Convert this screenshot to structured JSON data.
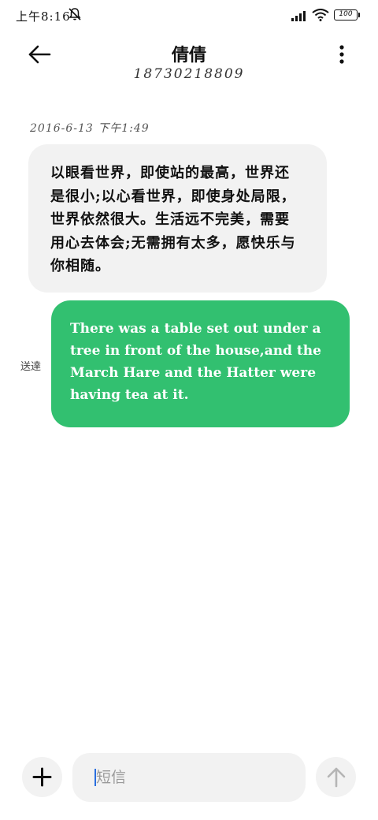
{
  "status_bar": {
    "time": "上午8:16",
    "battery": "100",
    "icons": [
      "mute-icon",
      "signal-icon",
      "wifi-icon",
      "battery-icon"
    ]
  },
  "header": {
    "contact_name": "倩倩",
    "contact_number": "18730218809",
    "icons": [
      "back-arrow-icon",
      "more-vertical-icon"
    ]
  },
  "conversation": {
    "timestamp": "2016-6-13 下午1:49",
    "messages": [
      {
        "direction": "incoming",
        "text": "以眼看世界，即使站的最高，世界还是很小;以心看世界，即使身处局限，世界依然很大。生活远不完美，需要用心去体会;无需拥有太多，愿快乐与你相随。"
      },
      {
        "direction": "outgoing",
        "status": "送達",
        "text": "There was a table set out under a tree in front of the house,and the March Hare and the Hatter were having tea at it."
      }
    ]
  },
  "composer": {
    "placeholder": "短信",
    "value": "",
    "icons": [
      "plus-icon",
      "send-arrow-icon"
    ]
  },
  "colors": {
    "outgoing_bubble": "#32c070",
    "incoming_bubble": "#f2f2f2",
    "cursor": "#2a6fe0"
  }
}
